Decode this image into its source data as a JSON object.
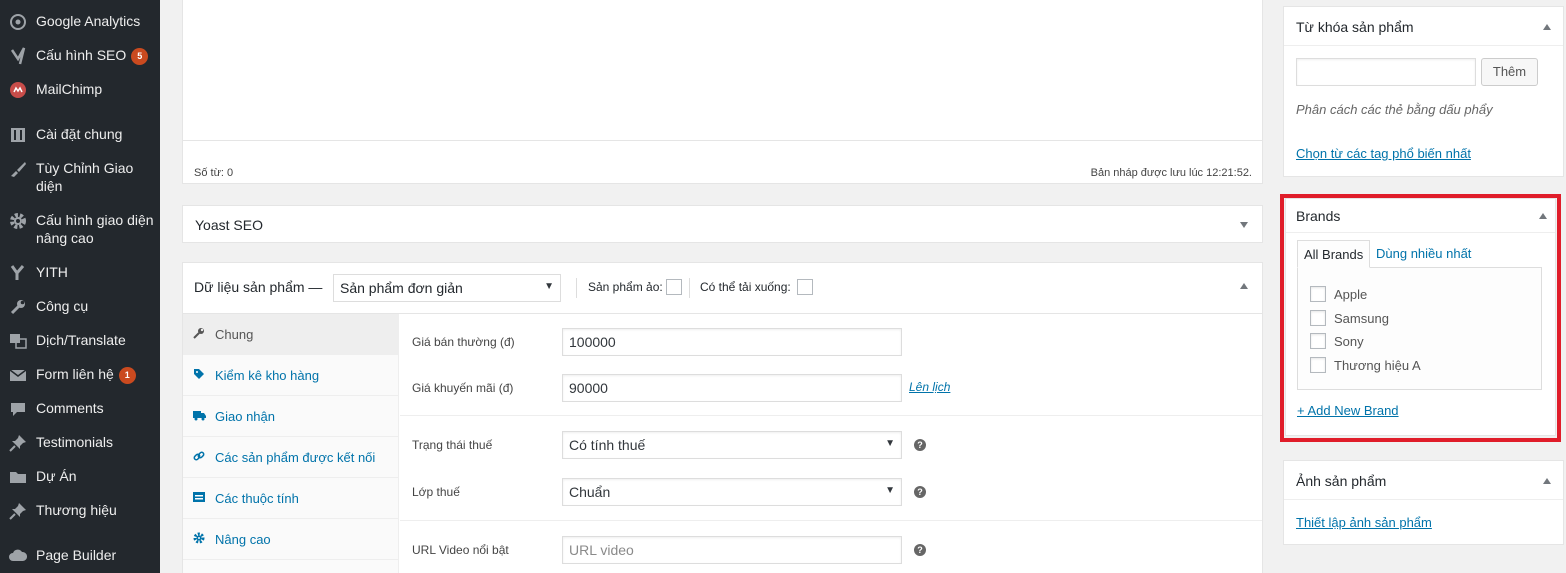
{
  "sidebar": {
    "items": [
      {
        "label": "Google Analytics",
        "icon": "analytics-icon"
      },
      {
        "label": "Cấu hình SEO",
        "icon": "yoast-icon",
        "badge": "5"
      },
      {
        "label": "MailChimp",
        "icon": "mailchimp-icon"
      },
      {
        "label": "Cài đặt chung",
        "icon": "settings-sliders-icon"
      },
      {
        "label": "Tùy Chỉnh Giao diện",
        "icon": "brush-icon"
      },
      {
        "label": "Cấu hình giao diện nâng cao",
        "icon": "gear-icon"
      },
      {
        "label": "YITH",
        "icon": "yith-icon"
      },
      {
        "label": "Công cụ",
        "icon": "wrench-icon"
      },
      {
        "label": "Dịch/Translate",
        "icon": "translate-icon"
      },
      {
        "label": "Form liên hệ",
        "icon": "mail-icon",
        "badge": "1"
      },
      {
        "label": "Comments",
        "icon": "comment-icon"
      },
      {
        "label": "Testimonials",
        "icon": "pin-icon"
      },
      {
        "label": "Dự Án",
        "icon": "folder-icon"
      },
      {
        "label": "Thương hiệu",
        "icon": "pin-icon"
      },
      {
        "label": "Page Builder",
        "icon": "cloud-icon"
      }
    ],
    "badge_color": "#ca4a1f"
  },
  "editor": {
    "word_count": "Số từ: 0",
    "draft_status": "Bản nháp được lưu lúc 12:21:52."
  },
  "yoast": {
    "title": "Yoast SEO"
  },
  "product_data": {
    "title": "Dữ liệu sản phẩm —",
    "type_select": "Sản phẩm đơn giản",
    "virtual_label": "Sản phẩm ảo:",
    "downloadable_label": "Có thể tải xuống:",
    "tabs": [
      {
        "label": "Chung",
        "icon": "wrench-icon"
      },
      {
        "label": "Kiểm kê kho hàng",
        "icon": "tag-icon"
      },
      {
        "label": "Giao nhận",
        "icon": "truck-icon"
      },
      {
        "label": "Các sản phẩm được kết nối",
        "icon": "link-icon"
      },
      {
        "label": "Các thuộc tính",
        "icon": "list-icon"
      },
      {
        "label": "Nâng cao",
        "icon": "gear-icon"
      }
    ],
    "regular_price_label": "Giá bán thường (đ)",
    "regular_price_value": "100000",
    "sale_price_label": "Giá khuyến mãi (đ)",
    "sale_price_value": "90000",
    "schedule_link": "Lên lịch",
    "tax_status_label": "Trạng thái thuế",
    "tax_status_value": "Có tính thuế",
    "tax_class_label": "Lớp thuế",
    "tax_class_value": "Chuẩn",
    "video_url_label": "URL Video nổi bật",
    "video_url_placeholder": "URL video"
  },
  "tags_box": {
    "title": "Từ khóa sản phẩm",
    "add_button": "Thêm",
    "hint": "Phân cách các thẻ bằng dấu phẩy",
    "choose_link": "Chọn từ các tag phổ biến nhất"
  },
  "brands_box": {
    "title": "Brands",
    "tab_all": "All Brands",
    "tab_popular": "Dùng nhiều nhất",
    "brands": [
      "Apple",
      "Samsung",
      "Sony",
      "Thương hiệu A"
    ],
    "add_link": "+ Add New Brand",
    "highlight_color": "#e01d2a"
  },
  "image_box": {
    "title": "Ảnh sản phẩm",
    "set_link": "Thiết lập ảnh sản phẩm"
  }
}
